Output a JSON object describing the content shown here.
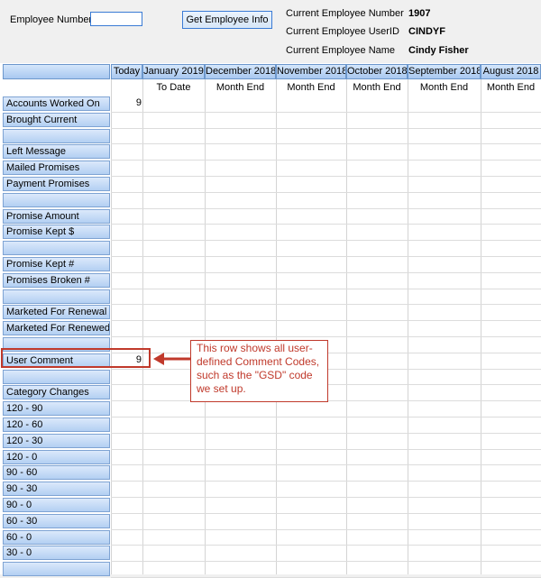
{
  "header": {
    "employee_number_label": "Employee Number",
    "employee_number_value": "",
    "get_button_label": "Get Employee Info",
    "current_number_label": "Current Employee Number",
    "current_number_value": "1907",
    "current_userid_label": "Current Employee UserID",
    "current_userid_value": "CINDYF",
    "current_name_label": "Current Employee Name",
    "current_name_value": "Cindy Fisher"
  },
  "grid": {
    "columns": [
      {
        "label": "Today",
        "sub": ""
      },
      {
        "label": "January 2019",
        "sub": "To Date"
      },
      {
        "label": "December 2018",
        "sub": "Month End"
      },
      {
        "label": "November 2018",
        "sub": "Month End"
      },
      {
        "label": "October 2018",
        "sub": "Month End"
      },
      {
        "label": "September 2018",
        "sub": "Month End"
      },
      {
        "label": "August 2018",
        "sub": "Month End"
      }
    ],
    "rows": [
      {
        "label": "Accounts Worked On",
        "today": "9"
      },
      {
        "label": "Brought Current",
        "today": ""
      },
      {
        "label": "",
        "today": ""
      },
      {
        "label": "Left Message",
        "today": ""
      },
      {
        "label": "Mailed Promises",
        "today": ""
      },
      {
        "label": "Payment Promises",
        "today": ""
      },
      {
        "label": "",
        "today": ""
      },
      {
        "label": "Promise Amount",
        "today": ""
      },
      {
        "label": "Promise Kept $",
        "today": ""
      },
      {
        "label": "",
        "today": ""
      },
      {
        "label": "Promise Kept #",
        "today": ""
      },
      {
        "label": "Promises Broken #",
        "today": ""
      },
      {
        "label": "",
        "today": ""
      },
      {
        "label": "Marketed For Renewal #",
        "today": ""
      },
      {
        "label": "Marketed For Renewed #",
        "today": ""
      },
      {
        "label": "",
        "today": ""
      },
      {
        "label": "User Comment",
        "today": "9"
      },
      {
        "label": "",
        "today": ""
      },
      {
        "label": "Category Changes",
        "today": ""
      },
      {
        "label": "120 - 90",
        "today": ""
      },
      {
        "label": "120 - 60",
        "today": ""
      },
      {
        "label": "120 - 30",
        "today": ""
      },
      {
        "label": "120 - 0",
        "today": ""
      },
      {
        "label": "90 - 60",
        "today": ""
      },
      {
        "label": "90 - 30",
        "today": ""
      },
      {
        "label": "90 - 0",
        "today": ""
      },
      {
        "label": "60 - 30",
        "today": ""
      },
      {
        "label": "60 - 0",
        "today": ""
      },
      {
        "label": "30 - 0",
        "today": ""
      },
      {
        "label": "",
        "today": ""
      }
    ]
  },
  "callout": {
    "text": "This row shows all user-defined Comment Codes, such as the \"GSD\" code we set up."
  },
  "colors": {
    "callout_red": "#c0392b",
    "header_blue": "#a9c8f0"
  }
}
